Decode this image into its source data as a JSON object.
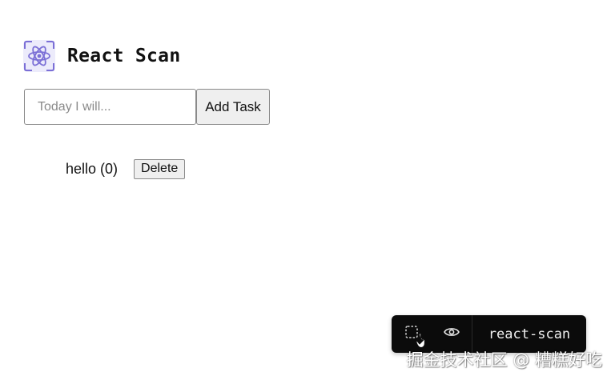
{
  "app": {
    "title": "React Scan",
    "logo_icon": "react-atom-icon"
  },
  "task_form": {
    "input_value": "",
    "input_placeholder": "Today I will...",
    "add_button_label": "Add Task"
  },
  "tasks": [
    {
      "text": "hello (0)",
      "delete_label": "Delete"
    }
  ],
  "toolbar": {
    "inspect_icon": "select-box-icon",
    "visibility_icon": "eye-icon",
    "label": "react-scan"
  },
  "watermark": "掘金技术社区 @ 糟糕好吃",
  "colors": {
    "logo_accent": "#7b6fd6",
    "toolbar_bg": "#0b0b0b"
  }
}
